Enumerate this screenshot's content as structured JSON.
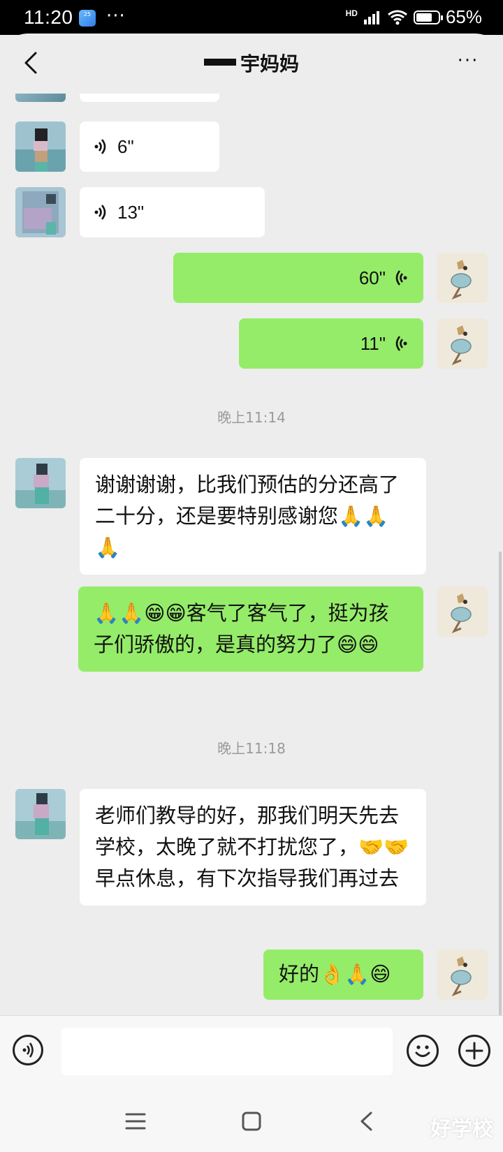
{
  "status_bar": {
    "time": "11:20",
    "app_badge": "25",
    "more": "···",
    "network": "HD",
    "battery_text": "65%",
    "battery_level": 0.65
  },
  "header": {
    "title": "宇妈妈",
    "back_icon": "chevron-left-icon",
    "more_icon": "ellipsis-icon",
    "more_text": "···"
  },
  "messages": [
    {
      "type": "voice",
      "side": "left",
      "duration": "6\""
    },
    {
      "type": "voice",
      "side": "left",
      "duration": "13\""
    },
    {
      "type": "voice",
      "side": "right",
      "duration": "60\""
    },
    {
      "type": "voice",
      "side": "right",
      "duration": "11\""
    },
    {
      "type": "time",
      "text": "晚上11:14"
    },
    {
      "type": "text",
      "side": "left",
      "text": "谢谢谢谢，比我们预估的分还高了二十分，还是要特别感谢您🙏🙏🙏"
    },
    {
      "type": "text",
      "side": "right",
      "text": "🙏🙏😁😁客气了客气了，挺为孩子们骄傲的，是真的努力了😄😄"
    },
    {
      "type": "time",
      "text": "晚上11:18"
    },
    {
      "type": "text",
      "side": "left",
      "text": "老师们教导的好，那我们明天先去学校，太晚了就不打扰您了，🤝🤝早点休息，有下次指导我们再过去"
    },
    {
      "type": "text",
      "side": "right",
      "text": "好的👌🙏😄"
    }
  ],
  "input_bar": {
    "placeholder": "",
    "voice_icon": "voice-mode-icon",
    "emoji_icon": "emoji-icon",
    "plus_icon": "plus-icon"
  },
  "navbar": {
    "menu_icon": "menu-icon",
    "home_icon": "home-square-icon",
    "back_icon": "back-triangle-icon"
  },
  "watermark": "好学校",
  "colors": {
    "chat_bg": "#ededed",
    "sent_bubble": "#95ec69",
    "received_bubble": "#ffffff",
    "timestamp": "#9a9a9a"
  }
}
